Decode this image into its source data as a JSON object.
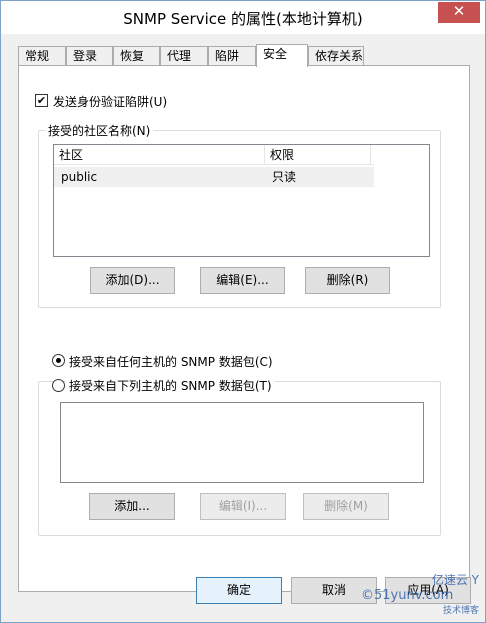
{
  "window": {
    "title": "SNMP Service 的属性(本地计算机)",
    "close_glyph": "✕"
  },
  "tabs": [
    "常规",
    "登录",
    "恢复",
    "代理",
    "陷阱",
    "安全",
    "依存关系"
  ],
  "active_tab": "安全",
  "auth_trap": {
    "label": "发送身份验证陷阱(U)",
    "checked": true,
    "check_glyph": "✔"
  },
  "community": {
    "group_label": "接受的社区名称(N)",
    "columns": [
      "社区",
      "权限"
    ],
    "rows": [
      {
        "name": "public",
        "permission": "只读"
      }
    ],
    "buttons": {
      "add": "添加(D)...",
      "edit": "编辑(E)...",
      "remove": "删除(R)"
    }
  },
  "hosts": {
    "option_any": "接受来自任何主机的 SNMP 数据包(C)",
    "option_list": "接受来自下列主机的 SNMP 数据包(T)",
    "selected": "any",
    "buttons": {
      "add": "添加...",
      "edit": "编辑(I)...",
      "remove": "删除(M)"
    }
  },
  "dialog_buttons": {
    "ok": "确定",
    "cancel": "取消",
    "apply": "应用(A)"
  },
  "watermark": {
    "line1": "亿速云 Y",
    "line2": "©51yunv.com",
    "line3": "技术博客"
  }
}
